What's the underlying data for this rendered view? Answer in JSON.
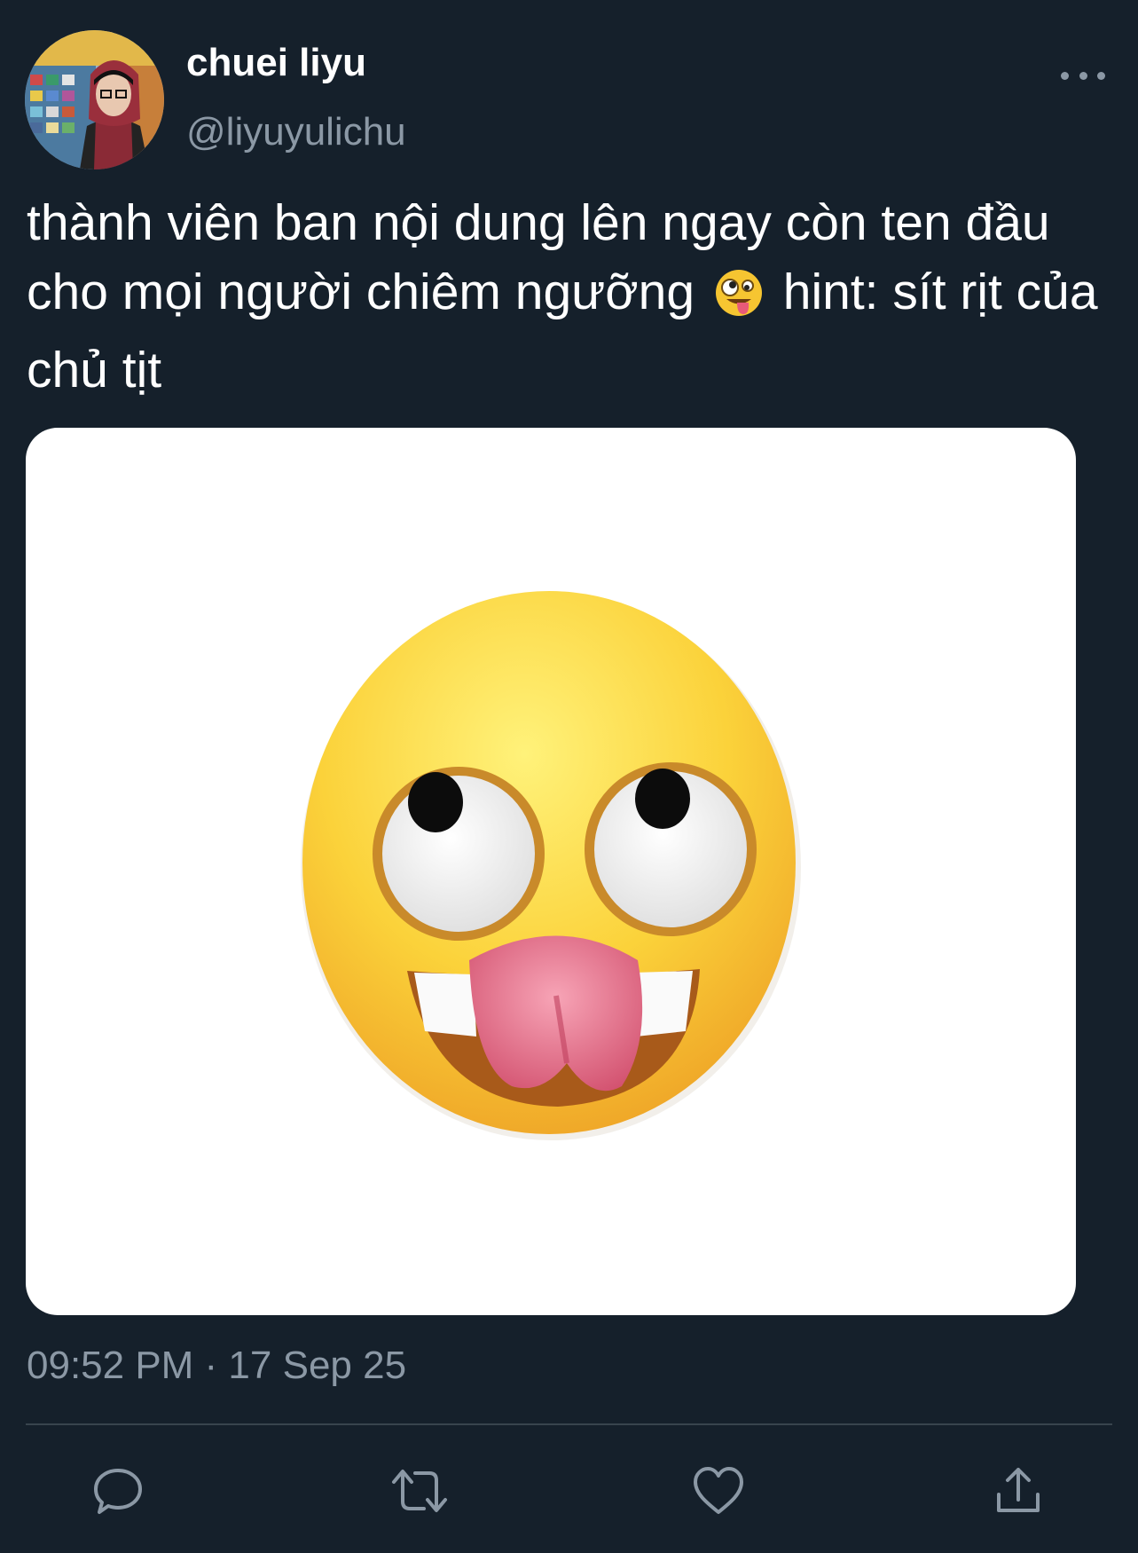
{
  "author": {
    "display_name": "chuei liyu",
    "handle": "@liyuyulichu"
  },
  "tweet": {
    "text": "thành viên ban nội dung lên ngay còn ten đầu cho mọi người chiêm ngưỡng",
    "emoji": "zany-face",
    "text_after": "hint: sít rịt của chủ tịt",
    "timestamp": "09:52 PM · 17 Sep 25"
  },
  "actions": [
    "reply",
    "retweet",
    "like",
    "share"
  ],
  "colors": {
    "background": "#15202b",
    "secondary_text": "#8b98a5",
    "divider": "#38444d"
  }
}
